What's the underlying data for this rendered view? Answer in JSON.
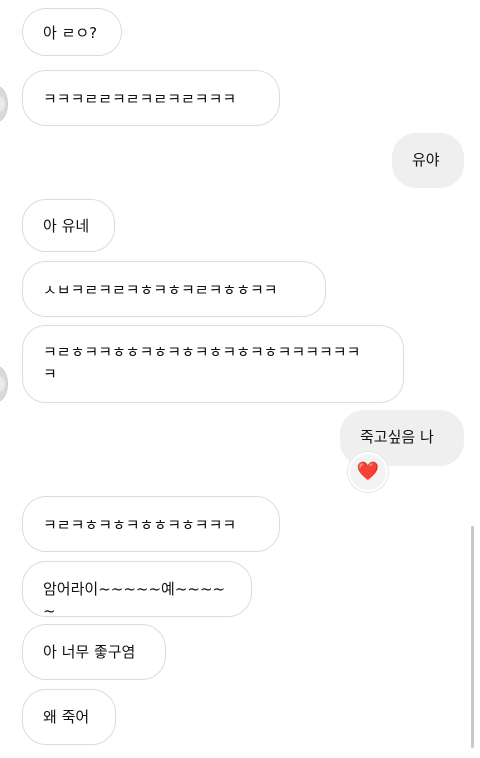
{
  "messages": [
    {
      "text": "아 ㄹㅇ?"
    },
    {
      "text": "ㅋㅋㅋㄹㄹㅋㄹㅋㄹㅋㄹㅋㅋㅋ"
    },
    {
      "text": "유야"
    },
    {
      "text": "아 유네"
    },
    {
      "text": "ㅅㅂㅋㄹㅋㄹㅋㅎㅋㅎㅋㄹㅋㅎㅎㅋㅋ"
    },
    {
      "text": "ㅋㄹㅎㅋㅋㅎㅎㅋㅎㅋㅎㅋㅎㅋㅎㅋㅎㅋㅋㅋㅋㅋㅋ\nㅋ"
    },
    {
      "text": "죽고싶음 나",
      "reaction": "❤️"
    },
    {
      "text": "ㅋㄹㅋㅎㅋㅎㅋㅎㅎㅋㅎㅋㅋㅋ"
    },
    {
      "text": "암어라이~~~~~예~~~~~"
    },
    {
      "text": "아 너무 좋구염"
    },
    {
      "text": "왜 죽어"
    }
  ],
  "colors": {
    "incoming_bubble_border": "#dcdcdc",
    "outgoing_bubble_bg": "#efefef",
    "reaction_heart": "#e0245e"
  },
  "icons": {
    "avatar": "avatar-icon",
    "reaction": "heart-icon"
  }
}
